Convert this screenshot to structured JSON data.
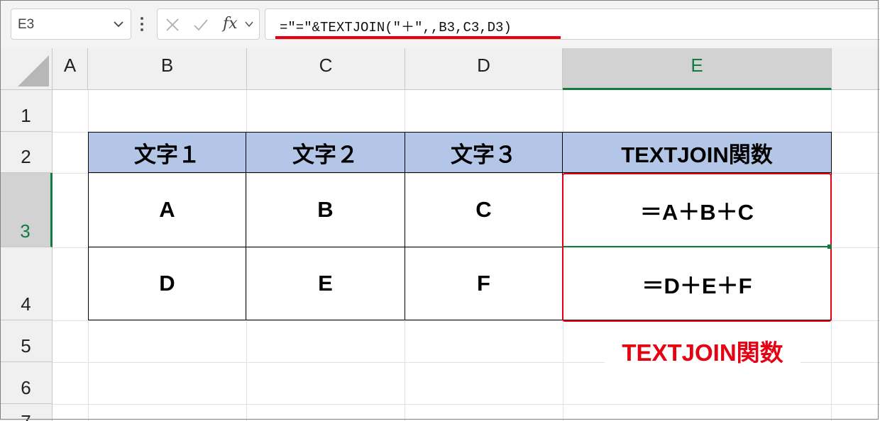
{
  "formula_bar": {
    "name_box": "E3",
    "formula": "=\"=\"&TEXTJOIN(\"＋\",,B3,C3,D3)",
    "fx_label": "fx"
  },
  "columns": [
    "A",
    "B",
    "C",
    "D",
    "E"
  ],
  "rows": [
    "1",
    "2",
    "3",
    "4",
    "5",
    "6",
    "7"
  ],
  "table": {
    "headers": [
      "文字１",
      "文字２",
      "文字３",
      "TEXTJOIN関数"
    ],
    "row3": [
      "A",
      "B",
      "C",
      "＝A＋B＋C"
    ],
    "row4": [
      "D",
      "E",
      "F",
      "＝D＋E＋F"
    ]
  },
  "annotation": "TEXTJOIN関数",
  "colors": {
    "header_fill": "#b4c6e7",
    "accent_red": "#e60012",
    "selection_green": "#107c41"
  }
}
